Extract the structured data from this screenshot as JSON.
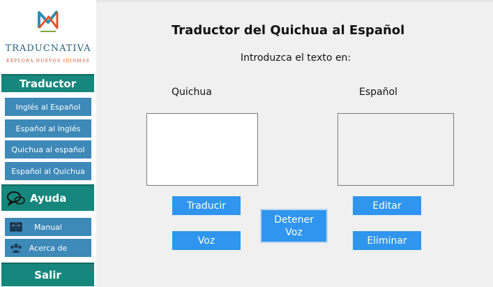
{
  "sidebar": {
    "logo": {
      "brand": "TRADUCNATIVA",
      "tagline": "EXPLORA NUEVOS IDIOMAS",
      "accent": "#d04a2a",
      "brand_color": "#1f5f7a"
    },
    "sections": {
      "traductor": {
        "label": "Traductor",
        "color": "#16877c"
      },
      "ayuda": {
        "label": "Ayuda",
        "icon": "chat-bubbles-icon"
      },
      "salir": {
        "label": "Salir"
      }
    },
    "translate_items": [
      {
        "label": "Inglés al Español"
      },
      {
        "label": "Español al Inglés"
      },
      {
        "label": "Quichua al español"
      },
      {
        "label": "Español al Quichua"
      }
    ],
    "help_items": [
      {
        "label": "Manual",
        "icon": "book-icon"
      },
      {
        "label": "Acerca de",
        "icon": "group-icon"
      }
    ],
    "item_color": "#3d89b8"
  },
  "main": {
    "title": "Traductor del Quichua al Español",
    "prompt": "Introduzca el texto en:",
    "source_label": "Quichua",
    "target_label": "Español",
    "source_text": "",
    "target_text": "",
    "buttons": {
      "translate": "Traducir",
      "voice": "Voz",
      "stop_voice": "Detener Voz",
      "edit": "Editar",
      "delete": "Eliminar"
    },
    "button_color": "#2f95ee"
  }
}
